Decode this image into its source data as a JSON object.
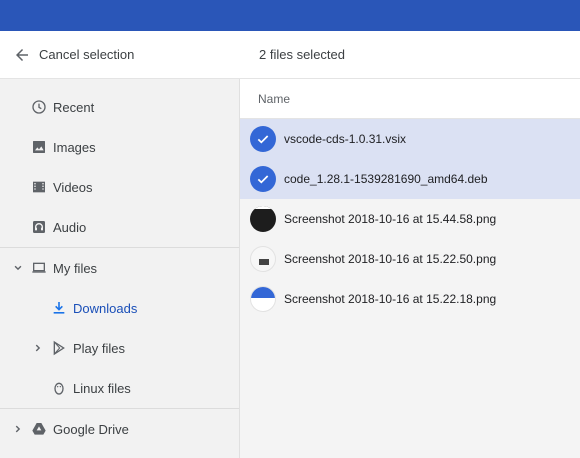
{
  "selection_bar": {
    "cancel_label": "Cancel selection",
    "count_label": "2 files selected"
  },
  "sidebar": {
    "items": [
      {
        "label": "Recent",
        "icon": "clock-icon"
      },
      {
        "label": "Images",
        "icon": "image-icon"
      },
      {
        "label": "Videos",
        "icon": "film-icon"
      },
      {
        "label": "Audio",
        "icon": "headphones-icon"
      },
      {
        "label": "My files",
        "icon": "laptop-icon",
        "expanded": true
      },
      {
        "label": "Downloads",
        "icon": "download-icon",
        "active": true
      },
      {
        "label": "Play files",
        "icon": "play-store-icon"
      },
      {
        "label": "Linux files",
        "icon": "penguin-icon"
      },
      {
        "label": "Google Drive",
        "icon": "drive-icon"
      }
    ]
  },
  "file_list": {
    "column_name": "Name",
    "rows": [
      {
        "name": "vscode-cds-1.0.31.vsix",
        "selected": true
      },
      {
        "name": "code_1.28.1-1539281690_amd64.deb",
        "selected": true
      },
      {
        "name": "Screenshot 2018-10-16 at 15.44.58.png",
        "selected": false
      },
      {
        "name": "Screenshot 2018-10-16 at 15.22.50.png",
        "selected": false
      },
      {
        "name": "Screenshot 2018-10-16 at 15.22.18.png",
        "selected": false
      }
    ]
  },
  "colors": {
    "top_bar": "#2a56b8",
    "accent": "#3367d6",
    "selected_row": "#dbe1f3",
    "sidebar_bg": "#f2f2f2"
  }
}
